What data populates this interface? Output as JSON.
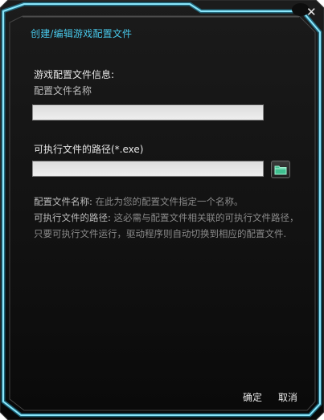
{
  "window": {
    "title": "创建/编辑游戏配置文件",
    "close_glyph": "✕"
  },
  "form": {
    "section_heading": "游戏配置文件信息:",
    "name_label": "配置文件名称",
    "name_value": "",
    "path_label": "可执行文件的路径(*.exe)",
    "path_value": "",
    "browse_icon": "folder-icon"
  },
  "help": {
    "name_key": "配置文件名称:",
    "name_text": "在此为您的配置文件指定一个名称。",
    "path_key": "可执行文件的路径:",
    "path_text": "这必需与配置文件相关联的可执行文件路径，只要可执行文件运行，驱动程序则自动切换到相应的配置文件."
  },
  "footer": {
    "ok_label": "确定",
    "cancel_label": "取消"
  },
  "colors": {
    "accent": "#48c8ea",
    "frame_glow": "#5fd8f5",
    "background": "#0c0c0c"
  }
}
